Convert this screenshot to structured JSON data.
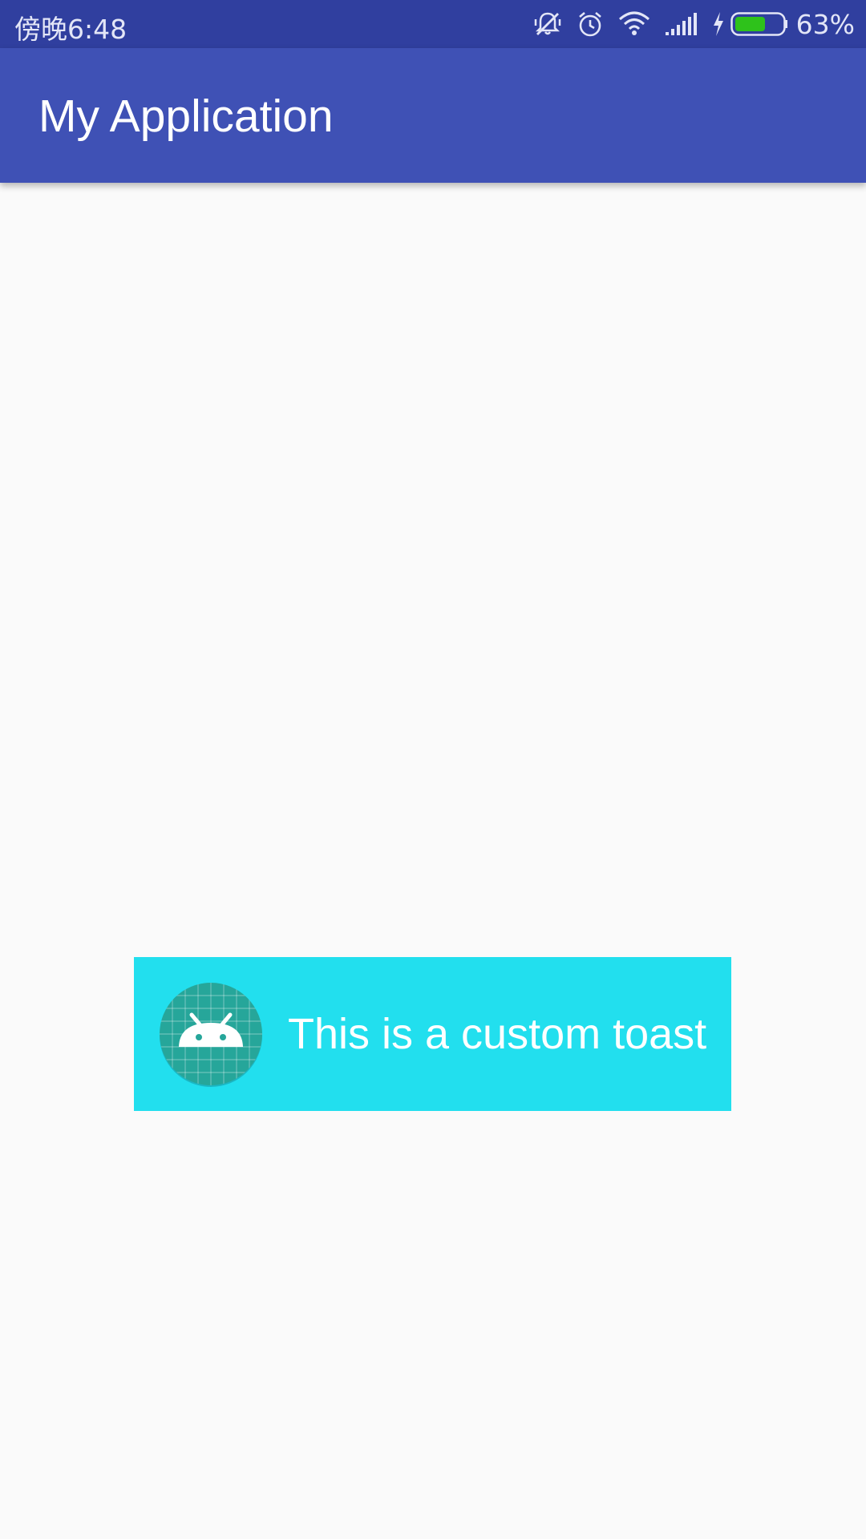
{
  "status_bar": {
    "time": "傍晚6:48",
    "battery_percent": "63%",
    "battery_level": 0.63,
    "icons": [
      "notifications-off-icon",
      "alarm-icon",
      "wifi-icon",
      "cell-signal-icon",
      "charging-icon",
      "battery-icon"
    ],
    "background_color": "#303f9f"
  },
  "app_bar": {
    "title": "My Application",
    "background_color": "#3f51b5"
  },
  "toast": {
    "message": "This is a custom toast",
    "icon": "android-launcher-icon",
    "background_color": "#22dfee"
  }
}
